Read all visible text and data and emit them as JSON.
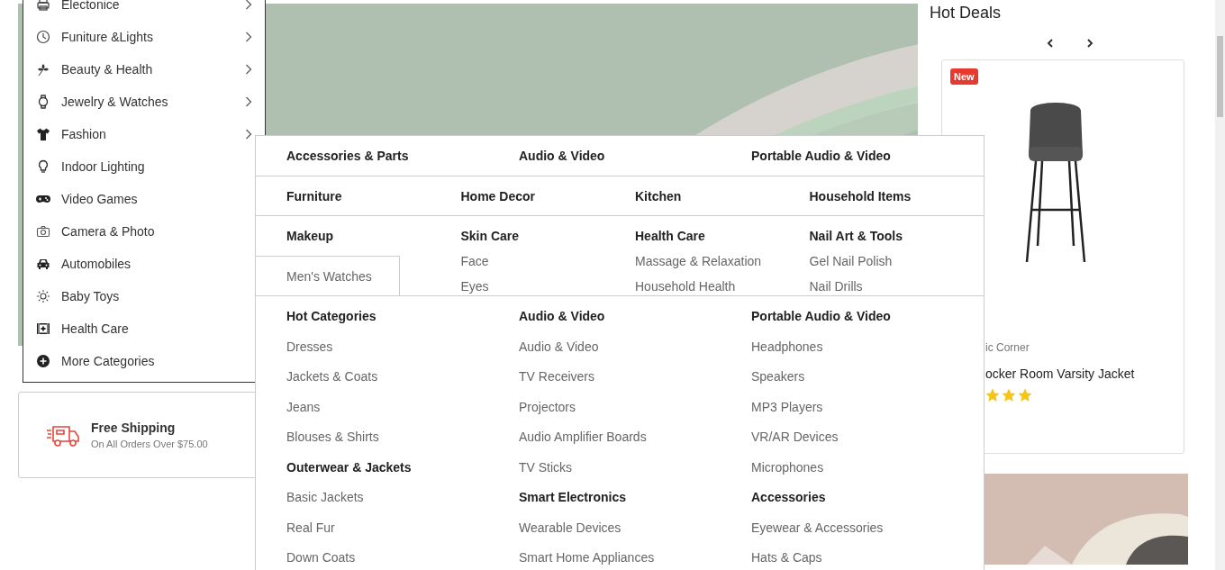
{
  "sidebar": {
    "items": [
      {
        "label": "Electonice",
        "submenu": true
      },
      {
        "label": "Funiture &Lights",
        "submenu": true
      },
      {
        "label": "Beauty & Health",
        "submenu": true
      },
      {
        "label": "Jewelry & Watches",
        "submenu": true
      },
      {
        "label": "Fashion",
        "submenu": true
      },
      {
        "label": "Indoor Lighting",
        "submenu": false
      },
      {
        "label": "Video Games",
        "submenu": false
      },
      {
        "label": "Camera & Photo",
        "submenu": false
      },
      {
        "label": "Automobiles",
        "submenu": false
      },
      {
        "label": "Baby Toys",
        "submenu": false
      },
      {
        "label": "Health Care",
        "submenu": false
      },
      {
        "label": "More Categories",
        "submenu": false
      }
    ]
  },
  "shipping": {
    "title": "Free Shipping",
    "subtitle": "On All Orders Over $75.00"
  },
  "hot_deals": {
    "title": "Hot Deals",
    "product": {
      "badge": "New",
      "brand": "ic Corner",
      "name": "ocker Room Varsity Jacket",
      "stars": 3
    }
  },
  "mega_menu": {
    "rows": [
      {
        "columns": [
          {
            "heading": "Accessories & Parts"
          },
          {
            "heading": "Audio & Video"
          },
          {
            "heading": "Portable Audio & Video"
          }
        ]
      },
      {
        "columns": [
          {
            "heading": "Furniture"
          },
          {
            "heading": "Home Decor"
          },
          {
            "heading": "Kitchen"
          },
          {
            "heading": "Household Items"
          }
        ]
      },
      {
        "columns": [
          {
            "heading": "Makeup"
          },
          {
            "heading": "Skin Care",
            "items": [
              "Face",
              "Eyes"
            ]
          },
          {
            "heading": "Health Care",
            "items": [
              "Massage & Relaxation",
              "Household Health"
            ]
          },
          {
            "heading": "Nail Art & Tools",
            "items": [
              "Gel Nail Polish",
              "Nail Drills"
            ]
          }
        ]
      }
    ],
    "flyout": "Men's Watches",
    "columns": [
      [
        {
          "heading": "Hot Categories",
          "items": [
            "Dresses",
            "Jackets & Coats",
            "Jeans",
            "Blouses & Shirts"
          ]
        },
        {
          "heading": "Outerwear & Jackets",
          "items": [
            "Basic Jackets",
            "Real Fur",
            "Down Coats"
          ]
        }
      ],
      [
        {
          "heading": "Audio & Video",
          "items": [
            "Audio & Video",
            "TV Receivers",
            "Projectors",
            "Audio Amplifier Boards",
            "TV Sticks"
          ]
        },
        {
          "heading": "Smart Electronics",
          "items": [
            "Wearable Devices",
            "Smart Home Appliances"
          ]
        }
      ],
      [
        {
          "heading": "Portable Audio & Video",
          "items": [
            "Headphones",
            "Speakers",
            "MP3 Players",
            "VR/AR Devices",
            "Microphones"
          ]
        },
        {
          "heading": "Accessories",
          "items": [
            "Eyewear & Accessories",
            "Hats & Caps"
          ]
        }
      ]
    ]
  }
}
